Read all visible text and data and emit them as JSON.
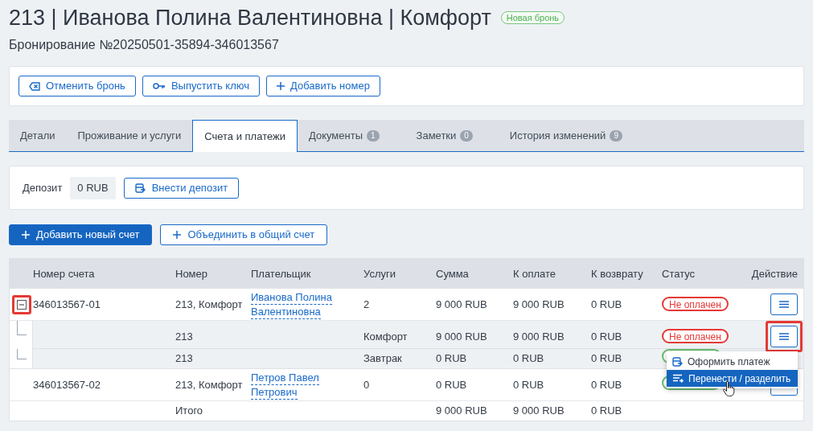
{
  "header": {
    "title": "213 | Иванова Полина Валентиновна | Комфорт",
    "badge": "Новая бронь",
    "subtitle": "Бронирование №20250501-35894-346013567"
  },
  "actions": [
    {
      "kind": "cancel",
      "label": "Отменить бронь"
    },
    {
      "kind": "key",
      "label": "Выпустить ключ"
    },
    {
      "kind": "plus",
      "label": "Добавить номер"
    }
  ],
  "tabs": [
    {
      "label": "Детали",
      "selected": false
    },
    {
      "label": "Проживание и услуги",
      "selected": false
    },
    {
      "label": "Счета и платежи",
      "selected": true
    },
    {
      "label": "Документы",
      "count": "1",
      "selected": false
    },
    {
      "label": "Заметки",
      "count": "0",
      "selected": false
    },
    {
      "label": "История изменений",
      "count": "9",
      "selected": false
    }
  ],
  "deposit": {
    "label": "Депозит",
    "value": "0 RUB",
    "button": "Внести депозит"
  },
  "table_buttons": [
    {
      "kind": "primary",
      "label": "Добавить новый счет"
    },
    {
      "kind": "outline",
      "label": "Объединить в общий счет"
    }
  ],
  "table": {
    "columns": [
      "Номер счета",
      "Номер",
      "Плательщик",
      "Услуги",
      "Сумма",
      "К оплате",
      "К возврату",
      "Статус",
      "Действие"
    ],
    "rows": [
      {
        "kind": "account",
        "expanded": true,
        "highlighted": true,
        "account": "346013567-01",
        "room": "213, Комфорт",
        "payer": [
          "Иванова Полина",
          "Валентиновна"
        ],
        "services": "2",
        "sum": "9 000 RUB",
        "to_pay": "9 000 RUB",
        "refund": "0 RUB",
        "status": {
          "text": "Не оплачен",
          "color": "#e53935"
        },
        "action": {
          "highlighted": false
        }
      },
      {
        "kind": "service",
        "room": "213",
        "service": "Комфорт",
        "sum": "9 000 RUB",
        "to_pay": "9 000 RUB",
        "refund": "0 RUB",
        "status": {
          "text": "Не оплачен",
          "color": "#e53935"
        },
        "action": {
          "highlighted": true
        }
      },
      {
        "kind": "service",
        "room": "213",
        "service": "Завтрак",
        "sum": "0 RUB",
        "to_pay": "0 RUB",
        "refund": "0 RUB",
        "status": {
          "color": "#66bb6a"
        }
      },
      {
        "kind": "account",
        "account": "346013567-02",
        "room": "213, Комфорт",
        "payer": [
          "Петров Павел",
          "Петрович"
        ],
        "services": "0",
        "sum": "0 RUB",
        "to_pay": "0 RUB",
        "refund": "0 RUB",
        "status": {
          "color": "#66bb6a"
        },
        "action": {
          "highlighted": false
        }
      },
      {
        "kind": "total",
        "room": "Итого",
        "sum": "9 000 RUB",
        "to_pay": "9 000 RUB",
        "refund": "0 RUB"
      }
    ]
  },
  "menu": [
    {
      "kind": "payment",
      "label": "Оформить платеж",
      "selected": false
    },
    {
      "kind": "transfer",
      "label": "Перенести / разделить",
      "selected": true
    }
  ]
}
